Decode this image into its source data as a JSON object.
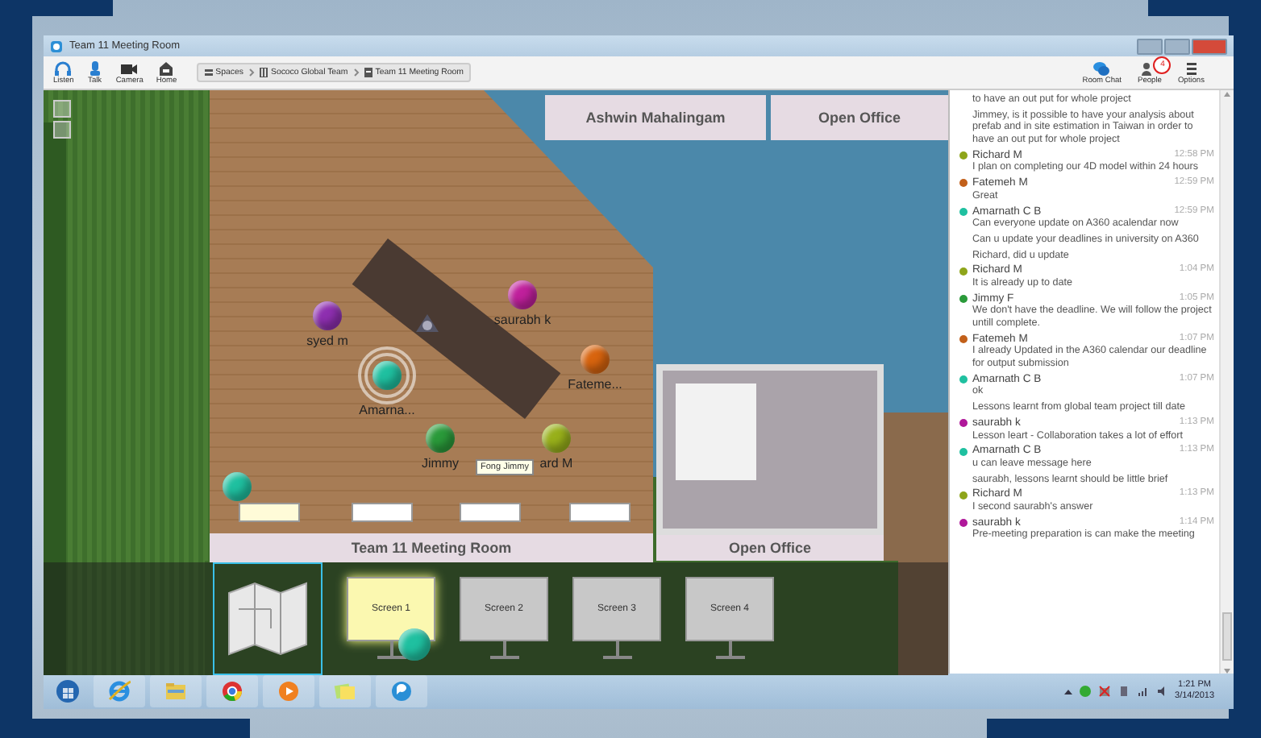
{
  "window": {
    "title": "Team 11 Meeting Room"
  },
  "toolbar": {
    "buttons": [
      {
        "kind": "listen",
        "label": "Listen"
      },
      {
        "kind": "talk",
        "label": "Talk"
      },
      {
        "kind": "camera",
        "label": "Camera"
      },
      {
        "kind": "home",
        "label": "Home"
      }
    ],
    "breadcrumb": [
      {
        "kind": "spaces",
        "label": "Spaces"
      },
      {
        "kind": "team",
        "label": "Sococo Global Team"
      },
      {
        "kind": "room",
        "label": "Team 11 Meeting Room"
      }
    ],
    "right_buttons": [
      {
        "kind": "chat",
        "label": "Room Chat"
      },
      {
        "kind": "people",
        "label": "People",
        "badge": "4"
      },
      {
        "kind": "options",
        "label": "Options"
      }
    ]
  },
  "map": {
    "room_labels": [
      "Ashwin Mahalingam",
      "Open Office",
      "Team 11 Meeting Room",
      "Open Office"
    ],
    "avatars": [
      {
        "name": "syed m",
        "color": "#8e2fb0",
        "speaking": false
      },
      {
        "name": "saurabh k",
        "color": "#c0209c",
        "speaking": false
      },
      {
        "name": "Fateme...",
        "color": "#d8640e",
        "speaking": false
      },
      {
        "name": "Amarna...",
        "color": "#1fc0a0",
        "speaking": true
      },
      {
        "name": "Jimmy",
        "color": "#2a9a3a",
        "speaking": false
      },
      {
        "name": "ard M",
        "color": "#98b01a",
        "speaking": false
      },
      {
        "color": "#1fc0a0",
        "speaking": false
      }
    ],
    "tooltip": "Fong Jimmy",
    "screens": [
      {
        "kind": "map",
        "selected": true,
        "on": false
      },
      {
        "kind": "screen",
        "label": "Screen 1",
        "selected": false,
        "on": true
      },
      {
        "kind": "screen",
        "label": "Screen 2",
        "selected": false,
        "on": false
      },
      {
        "kind": "screen",
        "label": "Screen 3",
        "selected": false,
        "on": false
      },
      {
        "kind": "screen",
        "label": "Screen 4",
        "selected": false,
        "on": false
      }
    ]
  },
  "chat": [
    {
      "kind": "continuation",
      "lines": [
        "to have an out put for whole project",
        "Jimmey, is it possible to have your analysis about prefab and in site estimation in Taiwan in order to have an out put for whole project"
      ]
    },
    {
      "kind": "message",
      "sender": "Richard M",
      "color": "#8ea51a",
      "time": "12:58 PM",
      "lines": [
        "I plan on completing our 4D model within 24 hours"
      ]
    },
    {
      "kind": "message",
      "sender": "Fatemeh M",
      "color": "#c2601a",
      "time": "12:59 PM",
      "lines": [
        "Great"
      ]
    },
    {
      "kind": "message",
      "sender": "Amarnath C B",
      "color": "#1fc0a0",
      "time": "12:59 PM",
      "lines": [
        "Can everyone update on A360 acalendar now",
        "Can u update your deadlines in university on A360",
        "Richard, did u update"
      ]
    },
    {
      "kind": "message",
      "sender": "Richard M",
      "color": "#8ea51a",
      "time": "1:04 PM",
      "lines": [
        "It is already up to date"
      ]
    },
    {
      "kind": "message",
      "sender": "Jimmy F",
      "color": "#2a9a3a",
      "time": "1:05 PM",
      "lines": [
        "We don't have the deadline. We will follow the project untill complete."
      ]
    },
    {
      "kind": "message",
      "sender": "Fatemeh M",
      "color": "#c2601a",
      "time": "1:07 PM",
      "lines": [
        "I already Updated in the A360 calendar our deadline for output submission"
      ]
    },
    {
      "kind": "message",
      "sender": "Amarnath C B",
      "color": "#1fc0a0",
      "time": "1:07 PM",
      "lines": [
        "ok",
        "Lessons learnt from global team project till date"
      ]
    },
    {
      "kind": "message",
      "sender": "saurabh k",
      "color": "#b0189a",
      "time": "1:13 PM",
      "lines": [
        "Lesson leart - Collaboration takes a lot of effort"
      ]
    },
    {
      "kind": "message",
      "sender": "Amarnath C B",
      "color": "#1fc0a0",
      "time": "1:13 PM",
      "lines": [
        "u can leave message here",
        "saurabh, lessons learnt should be little brief"
      ]
    },
    {
      "kind": "message",
      "sender": "Richard M",
      "color": "#8ea51a",
      "time": "1:13 PM",
      "lines": [
        "I second saurabh's answer"
      ]
    },
    {
      "kind": "message",
      "sender": "saurabh k",
      "color": "#b0189a",
      "time": "1:14 PM",
      "lines": [
        "Pre-meeting preparation is can make the meeting"
      ]
    }
  ],
  "taskbar": {
    "apps": [
      {
        "kind": "start"
      },
      {
        "kind": "browser"
      },
      {
        "kind": "folder"
      },
      {
        "kind": "chrome"
      },
      {
        "kind": "media"
      },
      {
        "kind": "notes"
      },
      {
        "kind": "chat"
      }
    ],
    "time": "1:21 PM",
    "date": "3/14/2013"
  }
}
